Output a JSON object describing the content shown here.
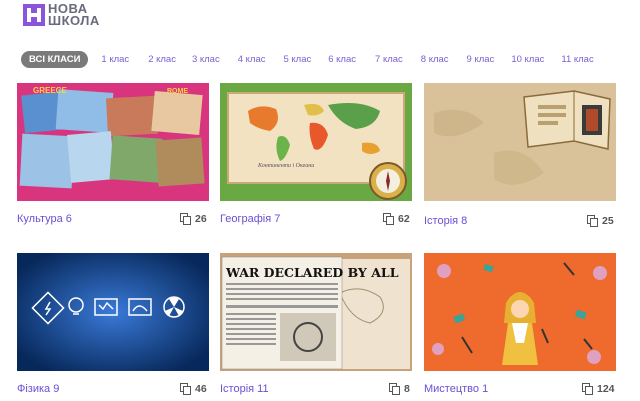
{
  "logo": {
    "line1": "НОВА",
    "line2": "ШКОЛА",
    "mark_color": "#8a55d8"
  },
  "filters": [
    {
      "label": "ВСІ КЛАСИ",
      "active": true
    },
    {
      "label": "1 клас"
    },
    {
      "label": "2 клас"
    },
    {
      "label": "3 клас"
    },
    {
      "label": "4 клас"
    },
    {
      "label": "5 клас"
    },
    {
      "label": "6 клас"
    },
    {
      "label": "7 клас"
    },
    {
      "label": "8 клас"
    },
    {
      "label": "9 клас"
    },
    {
      "label": "10 клас"
    },
    {
      "label": "11 клас"
    }
  ],
  "cards": [
    {
      "title": "Культура 6",
      "count": "26",
      "bg": "#d9357f"
    },
    {
      "title": "Географія 7",
      "count": "62",
      "bg": "#6aa844"
    },
    {
      "title": "Історія 8",
      "count": "25",
      "bg": "#cdb38c"
    },
    {
      "title": "Фізика 9",
      "count": "46",
      "bg": "#0e3d7a"
    },
    {
      "title": "Історія 11",
      "count": "8",
      "bg": "#c9a27a"
    },
    {
      "title": "Мистецтво 1",
      "count": "124",
      "bg": "#ee6a2d"
    }
  ],
  "thumb_text": {
    "culture_greece": "GREECE",
    "culture_rome": "ROME",
    "geo_caption": "Континенти і Океани",
    "news_headline": "WAR DECLARED BY ALL"
  },
  "accent_color": "#6b4fd3"
}
